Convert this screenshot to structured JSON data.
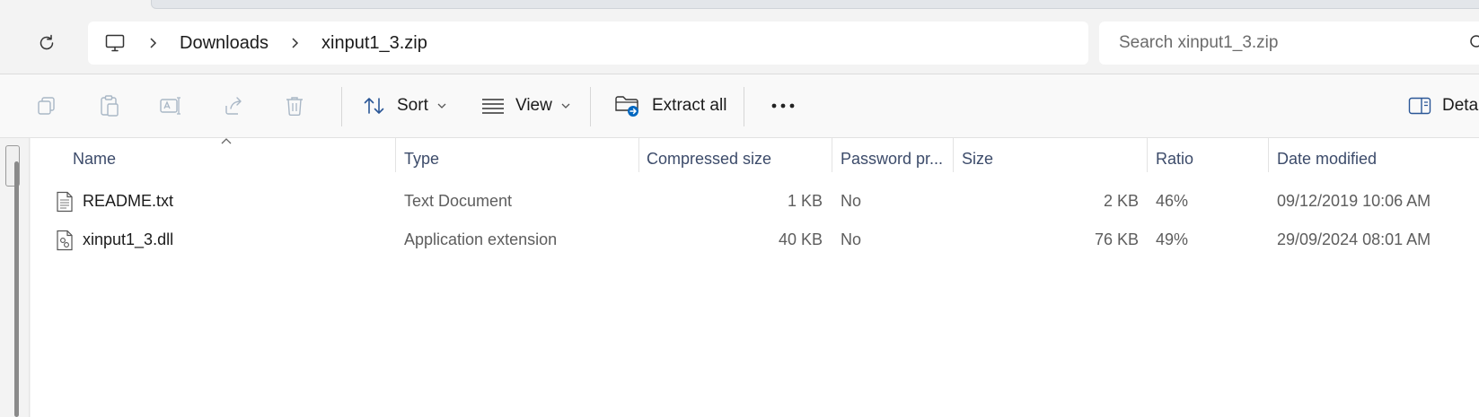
{
  "address": {
    "breadcrumbs": [
      "Downloads",
      "xinput1_3.zip"
    ],
    "root_icon": "this-pc-icon"
  },
  "search": {
    "placeholder": "Search xinput1_3.zip"
  },
  "toolbar": {
    "sort_label": "Sort",
    "view_label": "View",
    "extract_label": "Extract all",
    "details_label": "Details",
    "disabled_icons": [
      "copy-icon",
      "paste-icon",
      "rename-icon",
      "share-icon",
      "delete-icon"
    ]
  },
  "columns": {
    "name": "Name",
    "type": "Type",
    "compressed": "Compressed size",
    "password": "Password pr...",
    "size": "Size",
    "ratio": "Ratio",
    "modified": "Date modified"
  },
  "files": [
    {
      "name": "README.txt",
      "type": "Text Document",
      "compressed": "1 KB",
      "password": "No",
      "size": "2 KB",
      "ratio": "46%",
      "modified": "09/12/2019 10:06 AM",
      "icon": "text-file-icon"
    },
    {
      "name": "xinput1_3.dll",
      "type": "Application extension",
      "compressed": "40 KB",
      "password": "No",
      "size": "76 KB",
      "ratio": "49%",
      "modified": "29/09/2024 08:01 AM",
      "icon": "dll-file-icon"
    }
  ],
  "colors": {
    "header_text": "#3c4b6a",
    "accent": "#0067c0"
  }
}
